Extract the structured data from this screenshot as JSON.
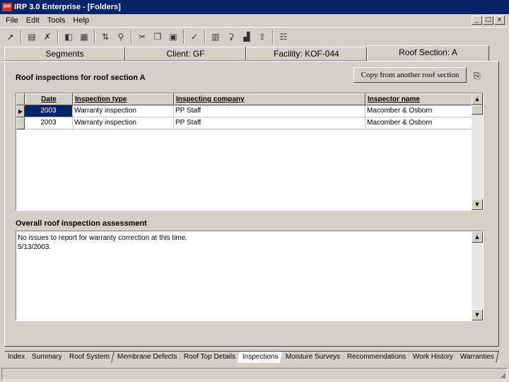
{
  "window": {
    "title": "IRP 3.0 Enterprise - [Folders]",
    "min": "_",
    "max": "□",
    "close": "x",
    "mdi_min": "_",
    "mdi_max": "□",
    "mdi_close": "x"
  },
  "menu": {
    "items": [
      "File",
      "Edit",
      "Tools",
      "Help"
    ]
  },
  "toolbar": {
    "icons": [
      "pointer-icon",
      "new-doc-icon",
      "delete-icon",
      "open-folder-icon",
      "table-icon",
      "sort-icon",
      "find-icon",
      "cut-icon",
      "copy-icon",
      "paste-icon",
      "spellcheck-icon",
      "calculator-icon",
      "antenna-icon",
      "chart-icon",
      "export-icon",
      "properties-icon"
    ]
  },
  "top_tabs": [
    {
      "label": "Segments",
      "active": false
    },
    {
      "label": "Client: GF",
      "active": false
    },
    {
      "label": "Facility: KOF-044",
      "active": false
    },
    {
      "label": "Roof Section: A",
      "active": true
    }
  ],
  "inspections": {
    "title": "Roof inspections for roof section A",
    "copy_button": "Copy from another roof section",
    "columns": [
      "Date",
      "Inspection type",
      "Inspecting company",
      "Inspector name"
    ],
    "rows": [
      {
        "date": "2003",
        "type": "Warranty inspection",
        "company": "PP Staff",
        "inspector": "Macomber & Osborn",
        "selected": true
      },
      {
        "date": "2003",
        "type": "Warranty inspection",
        "company": "PP Staff",
        "inspector": "Macomber & Osborn",
        "selected": false
      }
    ]
  },
  "assessment": {
    "title": "Overall roof inspection assessment",
    "text": "No issues to report for warranty correction at this time.\n5/13/2003."
  },
  "bottom_tabs": [
    {
      "label": "Index",
      "active": false
    },
    {
      "label": "Summary",
      "active": false
    },
    {
      "label": "Roof System",
      "active": false
    },
    {
      "label": "Membrane Defects",
      "active": false
    },
    {
      "label": "Roof Top Details",
      "active": false
    },
    {
      "label": "Inspections",
      "active": true
    },
    {
      "label": "Moisture Surveys",
      "active": false
    },
    {
      "label": "Recommendations",
      "active": false
    },
    {
      "label": "Work History",
      "active": false
    },
    {
      "label": "Warranties",
      "active": false
    }
  ]
}
